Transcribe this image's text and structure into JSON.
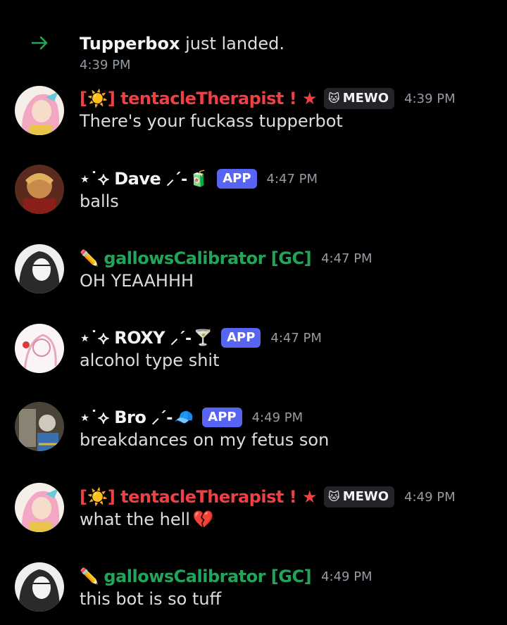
{
  "colors": {
    "background": "#000000",
    "text": "#dbdee1",
    "timestamp": "#949ba4",
    "app_badge": "#5865f2",
    "name_red": "#f23f43",
    "name_green": "#23a559",
    "name_white": "#f2f3f5",
    "arrow_green": "#23a559"
  },
  "system": {
    "icon": "join-arrow-icon",
    "user": "Tupperbox",
    "text": " just landed.",
    "time": "4:39 PM"
  },
  "messages": [
    {
      "prefix": "[☀️]",
      "name": " tentacleTherapist ! ★",
      "tag": "MEWO",
      "tag_icon": "cat-face-icon",
      "time": "4:39 PM",
      "content": "There's your fuckass tupperbot"
    },
    {
      "prefix": "⋆˙⟡",
      "name": "Dave",
      "suffix": "⸝ˊ-",
      "emoji": "🧃",
      "badge": "APP",
      "time": "4:47 PM",
      "content": "balls"
    },
    {
      "emoji": "✏️",
      "name": "gallowsCalibrator [GC]",
      "time": "4:47 PM",
      "content": "OH YEAAHHH"
    },
    {
      "prefix": "⋆˙⟡",
      "name": "ROXY",
      "suffix": "⸝ˊ-",
      "emoji": "🍸",
      "badge": "APP",
      "time": "4:47 PM",
      "content": "alcohol type shit"
    },
    {
      "prefix": "⋆˙⟡",
      "name": "Bro",
      "suffix": "⸝ˊ-",
      "emoji": "🧢",
      "badge": "APP",
      "time": "4:49 PM",
      "content": "breakdances on my fetus son"
    },
    {
      "prefix": "[☀️]",
      "name": " tentacleTherapist ! ★",
      "tag": "MEWO",
      "tag_icon": "cat-face-icon",
      "time": "4:49 PM",
      "content": "what the hell",
      "content_emoji": "💔"
    },
    {
      "emoji": "✏️",
      "name": "gallowsCalibrator [GC]",
      "time": "4:49 PM",
      "content": "this bot is so tuff"
    }
  ]
}
